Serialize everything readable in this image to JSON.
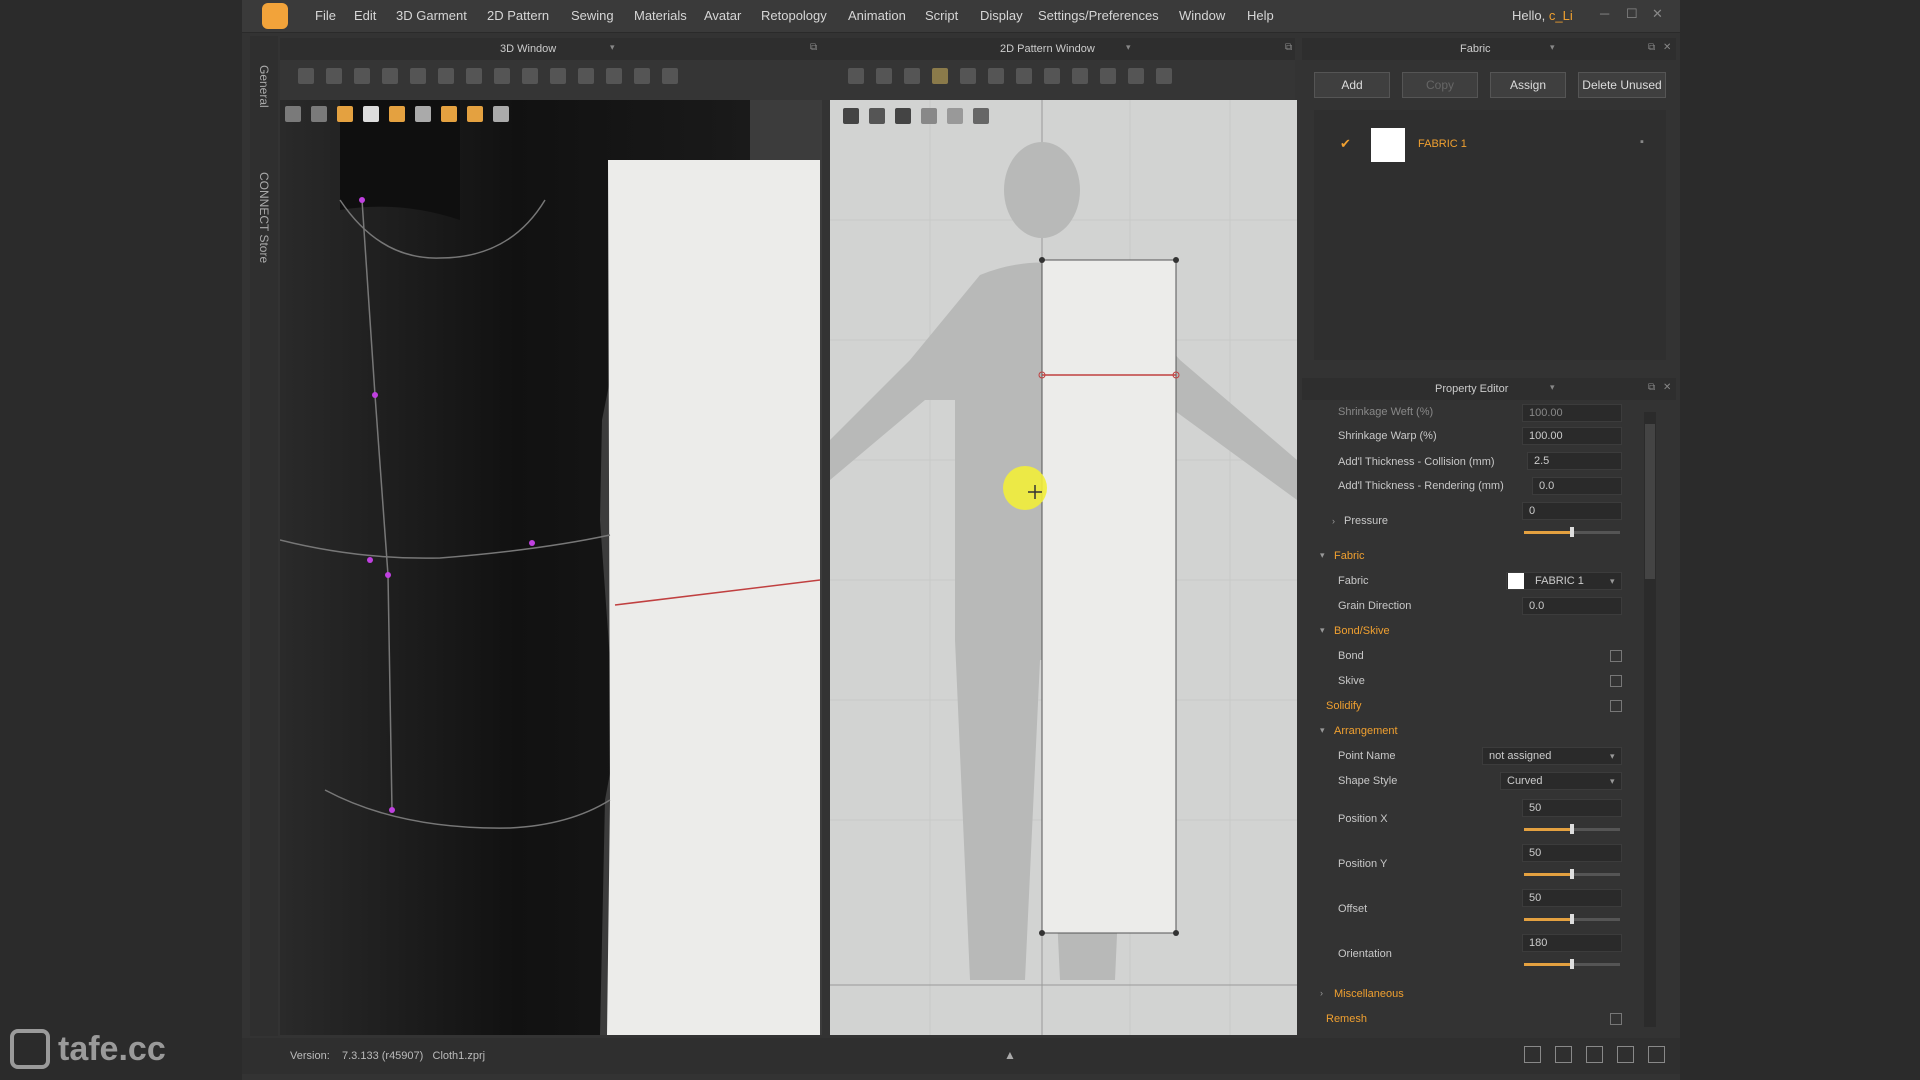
{
  "menu": [
    "File",
    "Edit",
    "3D Garment",
    "2D Pattern",
    "Sewing",
    "Materials",
    "Avatar",
    "Retopology",
    "Animation",
    "Script",
    "Display",
    "Settings/Preferences",
    "Window",
    "Help"
  ],
  "user": {
    "greeting": "Hello,",
    "name": "c_Li"
  },
  "side_tabs": [
    "General",
    "CONNECT Store"
  ],
  "windows": {
    "w3d": "3D Window",
    "w2d": "2D Pattern Window",
    "fabric": "Fabric",
    "property": "Property Editor"
  },
  "fabric_panel": {
    "buttons": {
      "add": "Add",
      "copy": "Copy",
      "assign": "Assign",
      "delete_unused": "Delete Unused"
    },
    "items": [
      {
        "name": "FABRIC 1",
        "checked": true
      }
    ]
  },
  "property_editor": {
    "rows": [
      {
        "label": "Shrinkage Weft (%)",
        "value": "100.00"
      },
      {
        "label": "Shrinkage Warp (%)",
        "value": "100.00"
      },
      {
        "label": "Add'l Thickness - Collision (mm)",
        "value": "2.5"
      },
      {
        "label": "Add'l Thickness - Rendering (mm)",
        "value": "0.0"
      }
    ],
    "pressure": {
      "label": "Pressure",
      "value": "0",
      "level": 0.5
    },
    "fabric_section": "Fabric",
    "fabric_label": "Fabric",
    "fabric_value": "FABRIC 1",
    "grain_label": "Grain Direction",
    "grain_value": "0.0",
    "bond_section": "Bond/Skive",
    "bond": "Bond",
    "skive": "Skive",
    "solidify": "Solidify",
    "arrangement_section": "Arrangement",
    "point_name_label": "Point Name",
    "point_name_value": "not assigned",
    "shape_style_label": "Shape Style",
    "shape_style_value": "Curved",
    "sliders": [
      {
        "label": "Position X",
        "value": "50",
        "level": 0.5
      },
      {
        "label": "Position Y",
        "value": "50",
        "level": 0.5
      },
      {
        "label": "Offset",
        "value": "50",
        "level": 0.5
      },
      {
        "label": "Orientation",
        "value": "180",
        "level": 0.5
      }
    ],
    "misc_section": "Miscellaneous",
    "remesh": "Remesh"
  },
  "status": {
    "version_label": "Version:",
    "version": "7.3.133 (r45907)",
    "file": "Cloth1.zprj"
  },
  "watermark": "tafe.cc",
  "colors": {
    "accent": "#f0a030",
    "seam_line": "#c04040",
    "avatar": "#1a1a1a",
    "pattern": "#ececea"
  }
}
